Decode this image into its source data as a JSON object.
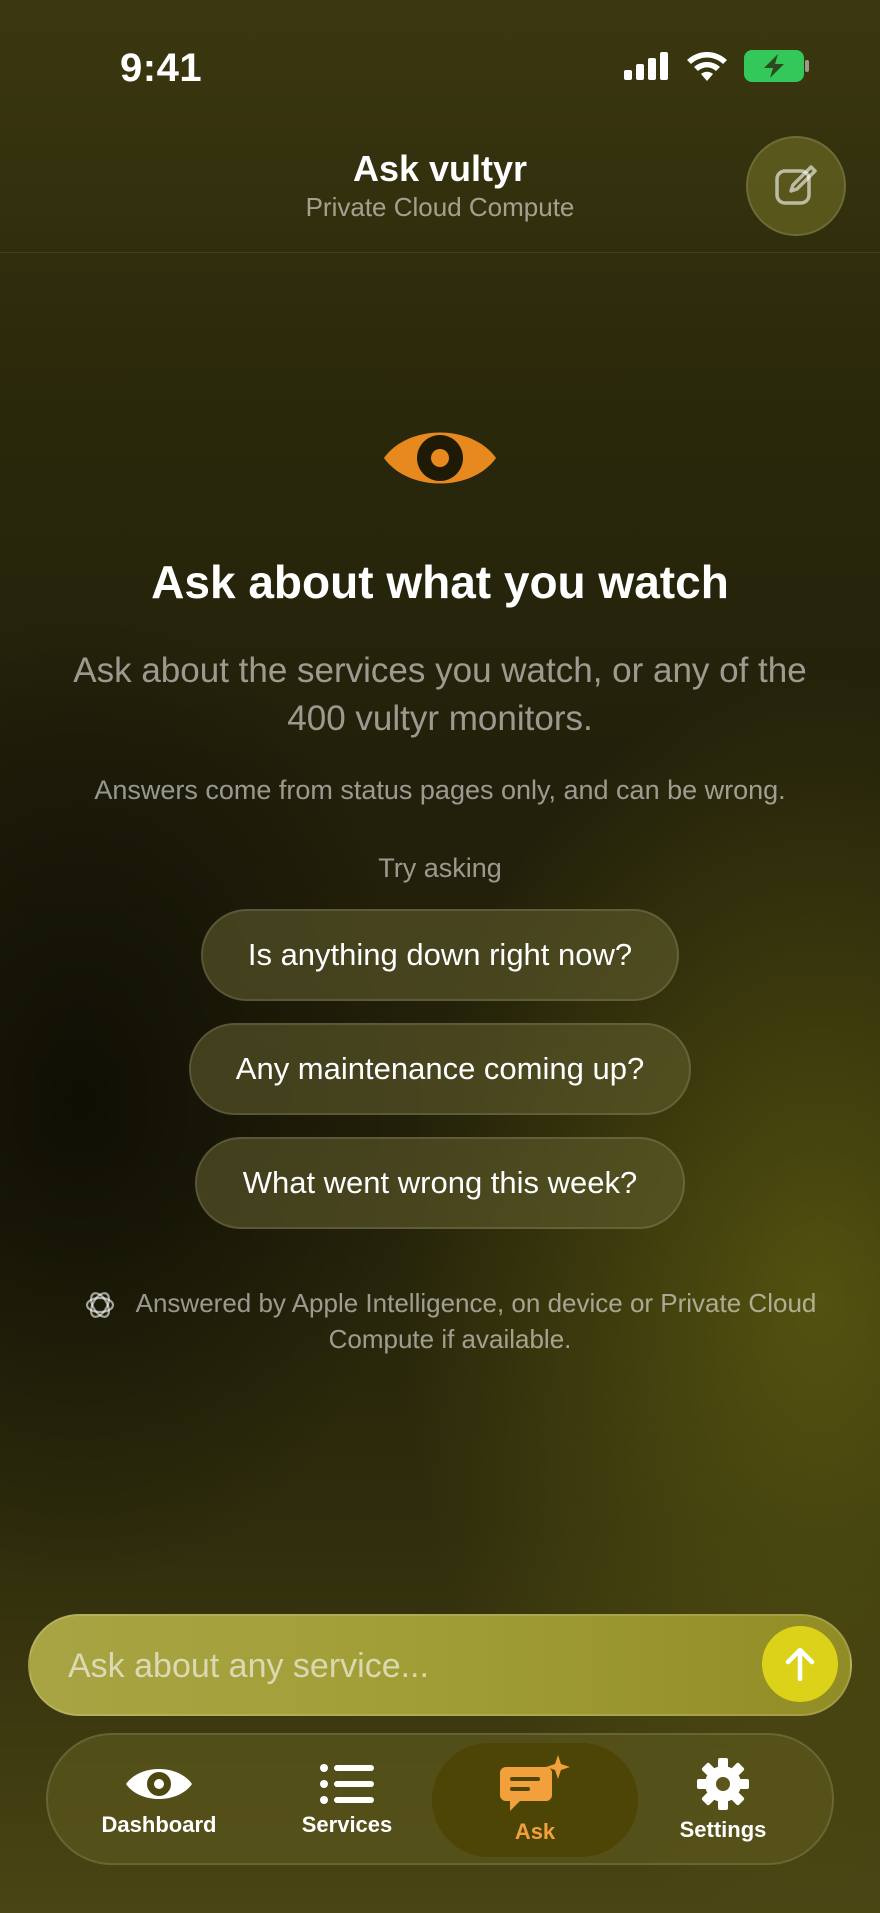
{
  "status_bar": {
    "time": "9:41",
    "icons": [
      "cellular-signal-icon",
      "wifi-icon",
      "battery-charging-icon"
    ]
  },
  "header": {
    "title": "Ask vultyr",
    "subtitle": "Private Cloud Compute",
    "compose_icon": "compose-icon"
  },
  "hero": {
    "icon": "eye-icon",
    "headline": "Ask about what you watch",
    "lead": "Ask about the services you watch, or any of the 400 vultyr monitors.",
    "note": "Answers come from status pages only, and can be wrong."
  },
  "suggestions": {
    "label": "Try asking",
    "items": [
      "Is anything down right now?",
      "Any maintenance coming up?",
      "What went wrong this week?"
    ]
  },
  "ai_note": {
    "icon": "apple-intelligence-icon",
    "text": "Answered by Apple Intelligence, on device or Private Cloud Compute if available."
  },
  "input": {
    "placeholder": "Ask about any service...",
    "value": "",
    "send_icon": "arrow-up-icon"
  },
  "tabs": [
    {
      "label": "Dashboard",
      "icon": "eye-icon",
      "active": false
    },
    {
      "label": "Services",
      "icon": "list-icon",
      "active": false
    },
    {
      "label": "Ask",
      "icon": "chat-sparkle-icon",
      "active": true
    },
    {
      "label": "Settings",
      "icon": "gear-icon",
      "active": false
    }
  ],
  "colors": {
    "accent": "#f2a03c",
    "eye_orange": "#e8891f",
    "send_button": "#dcd21a",
    "battery_green": "#34c759"
  }
}
